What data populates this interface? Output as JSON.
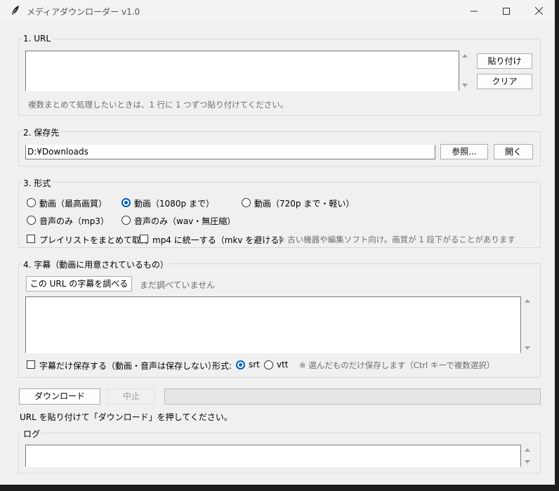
{
  "window": {
    "title": "メディアダウンローダー v1.0",
    "controls": [
      "minimize-icon",
      "maximize-icon",
      "close-icon"
    ]
  },
  "url_section": {
    "label": "1. URL",
    "value": "",
    "paste_label": "貼り付け",
    "clear_label": "クリア",
    "hint": "複数まとめて処理したいときは、1 行に 1 つずつ貼り付けてください。"
  },
  "save_section": {
    "label": "2. 保存先",
    "path": "D:¥Downloads",
    "browse_label": "参照...",
    "open_label": "開く"
  },
  "format_section": {
    "label": "3. 形式",
    "options": [
      {
        "label": "動画（最高画質）",
        "checked": false
      },
      {
        "label": "動画（1080p まで）",
        "checked": true
      },
      {
        "label": "動画（720p まで・軽い）",
        "checked": false
      },
      {
        "label": "音声のみ（mp3）",
        "checked": false
      },
      {
        "label": "音声のみ（wav・無圧縮）",
        "checked": false
      }
    ],
    "playlist_label": "プレイリストをまとめて取得",
    "mp4_label": "mp4 に統一する（mkv を避ける）",
    "mp4_note": "※ 古い機器や編集ソフト向け。画質が 1 段下がることがあります"
  },
  "subtitle_section": {
    "label": "4. 字幕（動画に用意されているもの）",
    "check_label": "この URL の字幕を調べる",
    "status": "まだ調べていません",
    "list_value": "",
    "only_label": "字幕だけ保存する（動画・音声は保存しない）",
    "format_label": "形式:",
    "formats": [
      {
        "label": "srt",
        "checked": true
      },
      {
        "label": "vtt",
        "checked": false
      }
    ],
    "note": "※ 選んだものだけ保存します（Ctrl キーで複数選択）"
  },
  "actions": {
    "download_label": "ダウンロード",
    "stop_label": "中止",
    "progress": 0,
    "status": "URL を貼り付けて「ダウンロード」を押してください。"
  },
  "log_section": {
    "label": "ログ",
    "value": ""
  }
}
